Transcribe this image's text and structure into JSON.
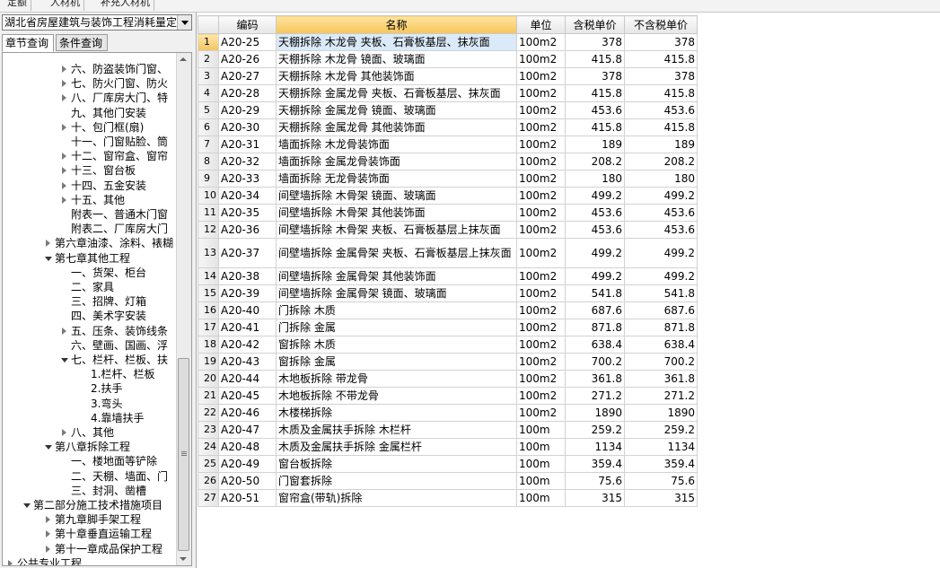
{
  "top_tabs": [
    "定额",
    "人材机",
    "补充人材机"
  ],
  "quota_library": "湖北省房屋建筑与装饰工程消耗量定额",
  "left_tabs": [
    "章节查询",
    "条件查询"
  ],
  "tree": [
    {
      "label": "六、防盗装饰门窗、",
      "level": 4,
      "state": "c"
    },
    {
      "label": "七、防火门窗、防火",
      "level": 4,
      "state": "c"
    },
    {
      "label": "八、厂库房大门、特",
      "level": 4,
      "state": "c"
    },
    {
      "label": "九、其他门安装",
      "level": 4,
      "state": "n"
    },
    {
      "label": "十、包门框(扇)",
      "level": 4,
      "state": "c"
    },
    {
      "label": "十一、门窗贴脸、筒",
      "level": 4,
      "state": "n"
    },
    {
      "label": "十二、窗帘盒、窗帘",
      "level": 4,
      "state": "c"
    },
    {
      "label": "十三、窗台板",
      "level": 4,
      "state": "c"
    },
    {
      "label": "十四、五金安装",
      "level": 4,
      "state": "c"
    },
    {
      "label": "十五、其他",
      "level": 4,
      "state": "c"
    },
    {
      "label": "附表一、普通木门窗",
      "level": 4,
      "state": "n"
    },
    {
      "label": "附表二、厂库房大门",
      "level": 4,
      "state": "n"
    },
    {
      "label": "第六章油漆、涂料、裱糊",
      "level": 3,
      "state": "c"
    },
    {
      "label": "第七章其他工程",
      "level": 3,
      "state": "e"
    },
    {
      "label": "一、货架、柜台",
      "level": 4,
      "state": "n"
    },
    {
      "label": "二、家具",
      "level": 4,
      "state": "n"
    },
    {
      "label": "三、招牌、灯箱",
      "level": 4,
      "state": "n"
    },
    {
      "label": "四、美术字安装",
      "level": 4,
      "state": "n"
    },
    {
      "label": "五、压条、装饰线条",
      "level": 4,
      "state": "c"
    },
    {
      "label": "六、壁画、国画、浮",
      "level": 4,
      "state": "n"
    },
    {
      "label": "七、栏杆、栏板、扶",
      "level": 4,
      "state": "e"
    },
    {
      "label": "1.栏杆、栏板",
      "level": 5,
      "state": "n"
    },
    {
      "label": "2.扶手",
      "level": 5,
      "state": "n"
    },
    {
      "label": "3.弯头",
      "level": 5,
      "state": "n"
    },
    {
      "label": "4.靠墙扶手",
      "level": 5,
      "state": "n"
    },
    {
      "label": "八、其他",
      "level": 4,
      "state": "c"
    },
    {
      "label": "第八章拆除工程",
      "level": 3,
      "state": "e"
    },
    {
      "label": "一、楼地面等铲除",
      "level": 4,
      "state": "n"
    },
    {
      "label": "二、天棚、墙面、门",
      "level": 4,
      "state": "n"
    },
    {
      "label": "三、封洞、凿槽",
      "level": 4,
      "state": "n"
    },
    {
      "label": "第二部分施工技术措施项目",
      "level": 2,
      "state": "e"
    },
    {
      "label": "第九章脚手架工程",
      "level": 3,
      "state": "c"
    },
    {
      "label": "第十章垂直运输工程",
      "level": 3,
      "state": "c"
    },
    {
      "label": "第十一章成品保护工程",
      "level": 3,
      "state": "c"
    },
    {
      "label": "公共专业工程",
      "level": 1,
      "state": "c"
    }
  ],
  "table": {
    "headers": [
      "",
      "编码",
      "名称",
      "单位",
      "含税单价",
      "不含税单价"
    ],
    "rows": [
      [
        "1",
        "A20-25",
        "天棚拆除 木龙骨 夹板、石膏板基层、抹灰面",
        "100m2",
        "378",
        "378"
      ],
      [
        "2",
        "A20-26",
        "天棚拆除 木龙骨 镜面、玻璃面",
        "100m2",
        "415.8",
        "415.8"
      ],
      [
        "3",
        "A20-27",
        "天棚拆除 木龙骨 其他装饰面",
        "100m2",
        "378",
        "378"
      ],
      [
        "4",
        "A20-28",
        "天棚拆除 金属龙骨 夹板、石膏板基层、抹灰面",
        "100m2",
        "415.8",
        "415.8"
      ],
      [
        "5",
        "A20-29",
        "天棚拆除 金属龙骨 镜面、玻璃面",
        "100m2",
        "453.6",
        "453.6"
      ],
      [
        "6",
        "A20-30",
        "天棚拆除 金属龙骨 其他装饰面",
        "100m2",
        "415.8",
        "415.8"
      ],
      [
        "7",
        "A20-31",
        "墙面拆除 木龙骨装饰面",
        "100m2",
        "189",
        "189"
      ],
      [
        "8",
        "A20-32",
        "墙面拆除 金属龙骨装饰面",
        "100m2",
        "208.2",
        "208.2"
      ],
      [
        "9",
        "A20-33",
        "墙面拆除 无龙骨装饰面",
        "100m2",
        "180",
        "180"
      ],
      [
        "10",
        "A20-34",
        "间壁墙拆除 木骨架 镜面、玻璃面",
        "100m2",
        "499.2",
        "499.2"
      ],
      [
        "11",
        "A20-35",
        "间壁墙拆除 木骨架 其他装饰面",
        "100m2",
        "453.6",
        "453.6"
      ],
      [
        "12",
        "A20-36",
        "间壁墙拆除 木骨架 夹板、石膏板基层上抹灰面",
        "100m2",
        "453.6",
        "453.6"
      ],
      [
        "13",
        "A20-37",
        "间壁墙拆除 金属骨架 夹板、石膏板基层上抹灰面",
        "100m2",
        "499.2",
        "499.2"
      ],
      [
        "14",
        "A20-38",
        "间壁墙拆除 金属骨架 其他装饰面",
        "100m2",
        "499.2",
        "499.2"
      ],
      [
        "15",
        "A20-39",
        "间壁墙拆除 金属骨架 镜面、玻璃面",
        "100m2",
        "541.8",
        "541.8"
      ],
      [
        "16",
        "A20-40",
        "门拆除 木质",
        "100m2",
        "687.6",
        "687.6"
      ],
      [
        "17",
        "A20-41",
        "门拆除 金属",
        "100m2",
        "871.8",
        "871.8"
      ],
      [
        "18",
        "A20-42",
        "窗拆除 木质",
        "100m2",
        "638.4",
        "638.4"
      ],
      [
        "19",
        "A20-43",
        "窗拆除 金属",
        "100m2",
        "700.2",
        "700.2"
      ],
      [
        "20",
        "A20-44",
        "木地板拆除 带龙骨",
        "100m2",
        "361.8",
        "361.8"
      ],
      [
        "21",
        "A20-45",
        "木地板拆除 不带龙骨",
        "100m2",
        "271.2",
        "271.2"
      ],
      [
        "22",
        "A20-46",
        "木楼梯拆除",
        "100m2",
        "1890",
        "1890"
      ],
      [
        "23",
        "A20-47",
        "木质及金属扶手拆除 木栏杆",
        "100m",
        "259.2",
        "259.2"
      ],
      [
        "24",
        "A20-48",
        "木质及金属扶手拆除 金属栏杆",
        "100m",
        "1134",
        "1134"
      ],
      [
        "25",
        "A20-49",
        "窗台板拆除",
        "100m",
        "359.4",
        "359.4"
      ],
      [
        "26",
        "A20-50",
        "门窗套拆除",
        "100m",
        "75.6",
        "75.6"
      ],
      [
        "27",
        "A20-51",
        "窗帘盒(带轨)拆除",
        "100m",
        "315",
        "315"
      ]
    ]
  }
}
